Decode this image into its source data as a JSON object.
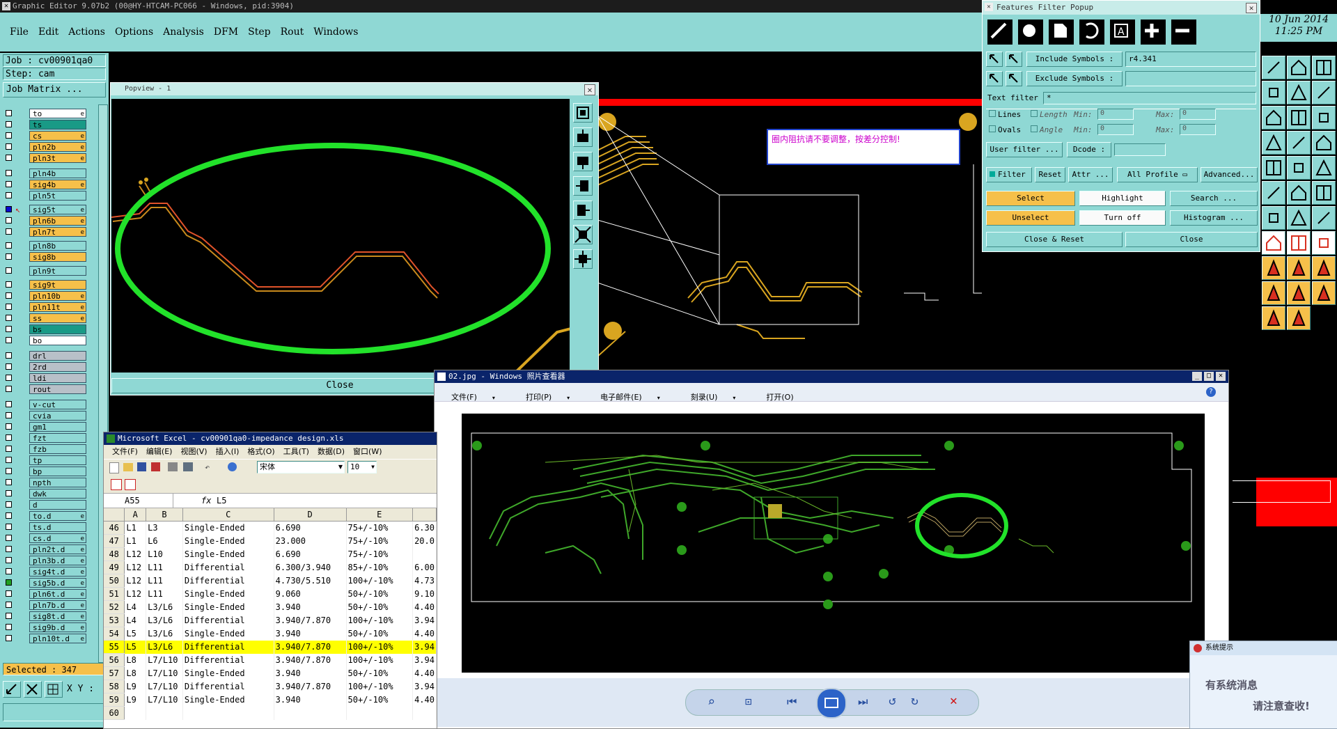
{
  "genesis": {
    "title": "Graphic Editor 9.07b2 (00@HY-HTCAM-PC066 - Windows, pid:3904)",
    "menu": [
      "File",
      "Edit",
      "Actions",
      "Options",
      "Analysis",
      "DFM",
      "Step",
      "Rout",
      "Windows"
    ],
    "job": "Job : cv00901qa0",
    "step": "Step: cam",
    "job_matrix": "Job Matrix ...",
    "selected": "Selected : 347",
    "xy_label": "X Y :",
    "date": "10 Jun 2014",
    "time": "11:25 PM",
    "annotation_note": "圈内阻抗请不要调整，按差分控制!",
    "layers": [
      {
        "name": "to",
        "color": "#ffffff",
        "mark": "e"
      },
      {
        "name": "ts",
        "color": "#199a86",
        "mark": ""
      },
      {
        "name": "cs",
        "color": "#f6c04a",
        "mark": "e"
      },
      {
        "name": "pln2b",
        "color": "#f6c04a",
        "mark": "e"
      },
      {
        "name": "pln3t",
        "color": "#f6c04a",
        "mark": "e"
      },
      {
        "name": "pln4b",
        "color": "#8fd8d4",
        "mark": ""
      },
      {
        "name": "sig4b",
        "color": "#f6c04a",
        "mark": "e"
      },
      {
        "name": "pln5t",
        "color": "#8fd8d4",
        "mark": ""
      },
      {
        "name": "sig5t",
        "color": "#8fd8d4",
        "mark": "e"
      },
      {
        "name": "pln6b",
        "color": "#f6c04a",
        "mark": "e"
      },
      {
        "name": "pln7t",
        "color": "#f6c04a",
        "mark": "e"
      },
      {
        "name": "pln8b",
        "color": "#8fd8d4",
        "mark": ""
      },
      {
        "name": "sig8b",
        "color": "#f6c04a",
        "mark": ""
      },
      {
        "name": "pln9t",
        "color": "#8fd8d4",
        "mark": ""
      },
      {
        "name": "sig9t",
        "color": "#f6c04a",
        "mark": ""
      },
      {
        "name": "pln10b",
        "color": "#f6c04a",
        "mark": "e"
      },
      {
        "name": "pln11t",
        "color": "#f6c04a",
        "mark": "e"
      },
      {
        "name": "ss",
        "color": "#f6c04a",
        "mark": "e"
      },
      {
        "name": "bs",
        "color": "#199a86",
        "mark": ""
      },
      {
        "name": "bo",
        "color": "#ffffff",
        "mark": ""
      },
      {
        "name": "drl",
        "color": "#b8c0c8",
        "mark": ""
      },
      {
        "name": "2rd",
        "color": "#b8c0c8",
        "mark": ""
      },
      {
        "name": "ldi",
        "color": "#b8c0c8",
        "mark": ""
      },
      {
        "name": "rout",
        "color": "#b8c0c8",
        "mark": ""
      },
      {
        "name": "v-cut",
        "color": "#8fd8d4",
        "mark": ""
      },
      {
        "name": "cvia",
        "color": "#8fd8d4",
        "mark": ""
      },
      {
        "name": "gm1",
        "color": "#8fd8d4",
        "mark": ""
      },
      {
        "name": "fzt",
        "color": "#8fd8d4",
        "mark": ""
      },
      {
        "name": "fzb",
        "color": "#8fd8d4",
        "mark": ""
      },
      {
        "name": "tp",
        "color": "#8fd8d4",
        "mark": ""
      },
      {
        "name": "bp",
        "color": "#8fd8d4",
        "mark": ""
      },
      {
        "name": "npth",
        "color": "#8fd8d4",
        "mark": ""
      },
      {
        "name": "dwk",
        "color": "#8fd8d4",
        "mark": ""
      },
      {
        "name": "d",
        "color": "#8fd8d4",
        "mark": ""
      },
      {
        "name": "to.d",
        "color": "#8fd8d4",
        "mark": "e"
      },
      {
        "name": "ts.d",
        "color": "#8fd8d4",
        "mark": ""
      },
      {
        "name": "cs.d",
        "color": "#8fd8d4",
        "mark": "e"
      },
      {
        "name": "pln2t.d",
        "color": "#8fd8d4",
        "mark": "e"
      },
      {
        "name": "pln3b.d",
        "color": "#8fd8d4",
        "mark": "e"
      },
      {
        "name": "sig4t.d",
        "color": "#8fd8d4",
        "mark": "e"
      },
      {
        "name": "sig5b.d",
        "color": "#8fd8d4",
        "mark": "e"
      },
      {
        "name": "pln6t.d",
        "color": "#8fd8d4",
        "mark": "e"
      },
      {
        "name": "pln7b.d",
        "color": "#8fd8d4",
        "mark": "e"
      },
      {
        "name": "sig8t.d",
        "color": "#8fd8d4",
        "mark": "e"
      },
      {
        "name": "sig9b.d",
        "color": "#8fd8d4",
        "mark": "e"
      },
      {
        "name": "pln10t.d",
        "color": "#8fd8d4",
        "mark": "e"
      }
    ]
  },
  "popview": {
    "title": "Popview - 1",
    "close": "Close"
  },
  "features_filter": {
    "title": "Features Filter Popup",
    "include_symbols": "Include Symbols :",
    "include_value": "r4.341",
    "exclude_symbols": "Exclude Symbols :",
    "exclude_value": "",
    "text_filter": "Text filter",
    "text_filter_value": "*",
    "lines": "Lines",
    "ovals": "Ovals",
    "length": "Length",
    "angle": "Angle",
    "min": "Min:",
    "max": "Max:",
    "min_value": "0",
    "max_value": "0",
    "user_filter": "User filter ...",
    "dcode": "Dcode :",
    "filter": "Filter",
    "reset": "Reset",
    "attr": "Attr ...",
    "all_profile": "All Profile",
    "advanced": "Advanced...",
    "select": "Select",
    "highlight": "Highlight",
    "search": "Search ...",
    "unselect": "Unselect",
    "turn_off": "Turn off",
    "histogram": "Histogram ...",
    "close_reset": "Close & Reset",
    "close": "Close"
  },
  "photo_viewer": {
    "title": "02.jpg - Windows 照片查看器",
    "menu": [
      "文件(F)",
      "打印(P)",
      "电子邮件(E)",
      "刻录(U)",
      "打开(O)"
    ]
  },
  "excel": {
    "title": "Microsoft Excel - cv00901qa0-impedance design.xls",
    "menu": [
      "文件(F)",
      "编辑(E)",
      "视图(V)",
      "插入(I)",
      "格式(O)",
      "工具(T)",
      "数据(D)",
      "窗口(W)"
    ],
    "font": "宋体",
    "font_size": "10",
    "cell_ref": "A55",
    "formula": "L5",
    "columns": [
      "A",
      "B",
      "C",
      "D",
      "E"
    ],
    "rows": [
      {
        "n": "46",
        "a": "L1",
        "b": "L3",
        "c": "Single-Ended",
        "d": "6.690",
        "e": "75+/-10%",
        "f": "6.30"
      },
      {
        "n": "47",
        "a": "L1",
        "b": "L6",
        "c": "Single-Ended",
        "d": "23.000",
        "e": "75+/-10%",
        "f": "20.0"
      },
      {
        "n": "48",
        "a": "L12",
        "b": "L10",
        "c": "Single-Ended",
        "d": "6.690",
        "e": "75+/-10%",
        "f": ""
      },
      {
        "n": "49",
        "a": "L12",
        "b": "L11",
        "c": "Differential",
        "d": "6.300/3.940",
        "e": "85+/-10%",
        "f": "6.00"
      },
      {
        "n": "50",
        "a": "L12",
        "b": "L11",
        "c": "Differential",
        "d": "4.730/5.510",
        "e": "100+/-10%",
        "f": "4.73"
      },
      {
        "n": "51",
        "a": "L12",
        "b": "L11",
        "c": "Single-Ended",
        "d": "9.060",
        "e": "50+/-10%",
        "f": "9.10"
      },
      {
        "n": "52",
        "a": "L4",
        "b": "L3/L6",
        "c": "Single-Ended",
        "d": "3.940",
        "e": "50+/-10%",
        "f": "4.40"
      },
      {
        "n": "53",
        "a": "L4",
        "b": "L3/L6",
        "c": "Differential",
        "d": "3.940/7.870",
        "e": "100+/-10%",
        "f": "3.94"
      },
      {
        "n": "54",
        "a": "L5",
        "b": "L3/L6",
        "c": "Single-Ended",
        "d": "3.940",
        "e": "50+/-10%",
        "f": "4.40"
      },
      {
        "n": "55",
        "a": "L5",
        "b": "L3/L6",
        "c": "Differential",
        "d": "3.940/7.870",
        "e": "100+/-10%",
        "f": "3.94"
      },
      {
        "n": "56",
        "a": "L8",
        "b": "L7/L10",
        "c": "Differential",
        "d": "3.940/7.870",
        "e": "100+/-10%",
        "f": "3.94"
      },
      {
        "n": "57",
        "a": "L8",
        "b": "L7/L10",
        "c": "Single-Ended",
        "d": "3.940",
        "e": "50+/-10%",
        "f": "4.40"
      },
      {
        "n": "58",
        "a": "L9",
        "b": "L7/L10",
        "c": "Differential",
        "d": "3.940/7.870",
        "e": "100+/-10%",
        "f": "3.94"
      },
      {
        "n": "59",
        "a": "L9",
        "b": "L7/L10",
        "c": "Single-Ended",
        "d": "3.940",
        "e": "50+/-10%",
        "f": "4.40"
      },
      {
        "n": "60",
        "a": "",
        "b": "",
        "c": "",
        "d": "",
        "e": "",
        "f": ""
      }
    ]
  },
  "system_popup": {
    "title": "系统提示",
    "line1": "有系统消息",
    "line2": "请注意查收!"
  }
}
